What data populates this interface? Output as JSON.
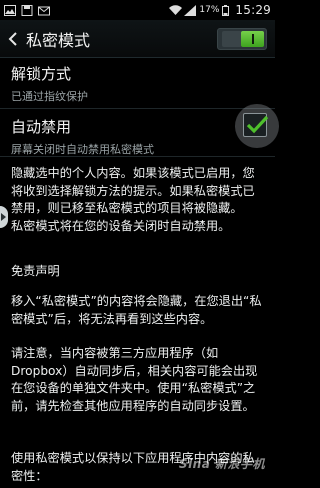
{
  "status_bar": {
    "battery": "17%",
    "time": "15:29",
    "icons": [
      "image-icon",
      "save-icon",
      "mail-icon",
      "wifi-icon",
      "signal-icon",
      "battery-icon"
    ]
  },
  "action_bar": {
    "title": "私密模式",
    "toggle_on": true
  },
  "settings": {
    "unlock_method": {
      "title": "解锁方式",
      "subtitle": "已通过指纹保护"
    },
    "auto_disable": {
      "title": "自动禁用",
      "subtitle": "屏幕关闭时自动禁用私密模式",
      "checked": true
    }
  },
  "content": {
    "p1": "隐藏选中的个人内容。如果该模式已启用，您将收到选择解锁方法的提示。如果私密模式已禁用，则已移至私密模式的项目将被隐藏。\n私密模式将在您的设备关闭时自动禁用。",
    "p2": "免责声明",
    "p3": "移入“私密模式”的内容将会隐藏，在您退出“私密模式”后，将无法再看到这些内容。",
    "p4": "请注意，当内容被第三方应用程序（如Dropbox）自动同步后，相关内容可能会出现在您设备的单独文件夹中。使用“私密模式”之前，请先检查其他应用程序的自动同步设置。",
    "p5": "使用私密模式以保持以下应用程序中内容的私密性："
  },
  "watermark": "Sina 新浪手机",
  "colors": {
    "accent_green": "#4fbf2c",
    "background": "#000000"
  }
}
